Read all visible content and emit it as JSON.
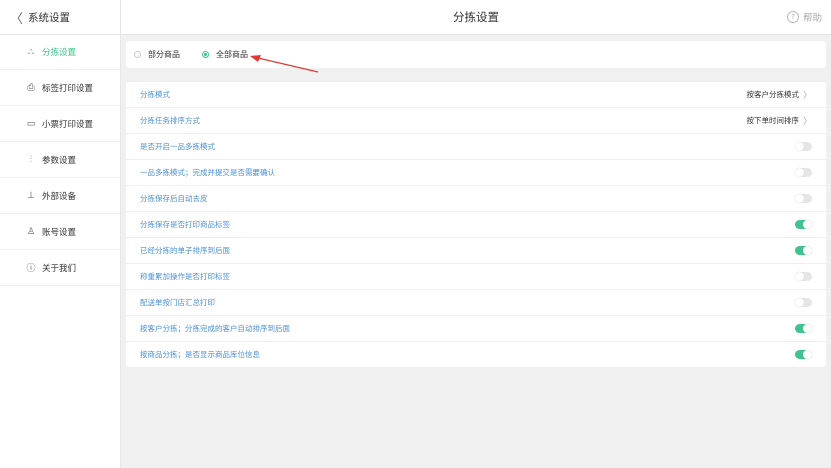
{
  "header": {
    "back_label": "系统设置",
    "title": "分拣设置",
    "help_label": "帮助"
  },
  "sidebar": {
    "items": [
      {
        "label": "分拣设置",
        "icon": "sort-icon",
        "active": true
      },
      {
        "label": "标签打印设置",
        "icon": "printer-icon",
        "active": false
      },
      {
        "label": "小票打印设置",
        "icon": "receipt-printer-icon",
        "active": false
      },
      {
        "label": "参数设置",
        "icon": "sliders-icon",
        "active": false
      },
      {
        "label": "外部设备",
        "icon": "scale-icon",
        "active": false
      },
      {
        "label": "账号设置",
        "icon": "user-icon",
        "active": false
      },
      {
        "label": "关于我们",
        "icon": "info-icon",
        "active": false
      }
    ]
  },
  "scope": {
    "options": [
      {
        "label": "部分商品",
        "selected": false
      },
      {
        "label": "全部商品",
        "selected": true
      }
    ]
  },
  "settings": {
    "rows": [
      {
        "label": "分拣模式",
        "value": "按客户分拣模式",
        "type": "select"
      },
      {
        "label": "分拣任务排序方式",
        "value": "按下单时间排序",
        "type": "select"
      },
      {
        "label": "是否开启一品多拣模式",
        "type": "toggle",
        "on": false
      },
      {
        "label": "一品多拣模式；完成并提交是否需要确认",
        "type": "toggle",
        "on": false
      },
      {
        "label": "分拣保存后自动去皮",
        "type": "toggle",
        "on": false
      },
      {
        "label": "分拣保存是否打印商品标签",
        "type": "toggle",
        "on": true
      },
      {
        "label": "已经分拣的单子排序到后面",
        "type": "toggle",
        "on": true
      },
      {
        "label": "称重累加操作是否打印标签",
        "type": "toggle",
        "on": false
      },
      {
        "label": "配送单按门店汇总打印",
        "type": "toggle",
        "on": false
      },
      {
        "label": "按客户分拣；分拣完成的客户自动排序到后面",
        "type": "toggle",
        "on": true
      },
      {
        "label": "按商品分拣；是否显示商品库位信息",
        "type": "toggle",
        "on": true
      }
    ]
  },
  "colors": {
    "accent": "#3fc38c",
    "link": "#4a90d9",
    "annotation": "#e53935"
  }
}
